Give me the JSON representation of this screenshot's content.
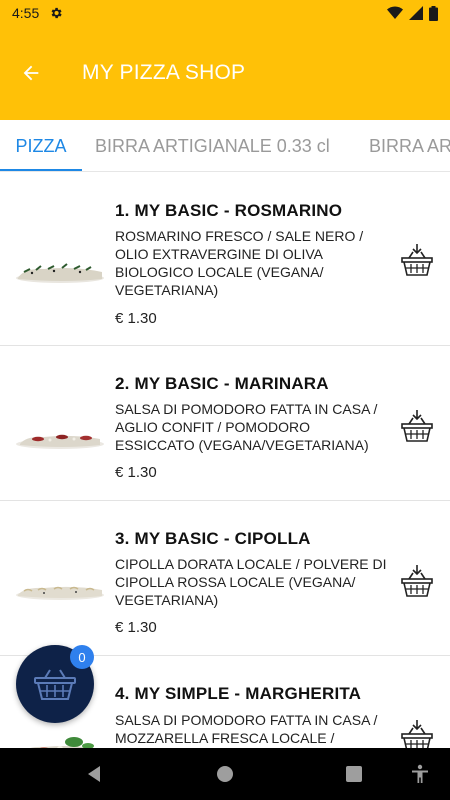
{
  "status": {
    "time": "4:55"
  },
  "appbar": {
    "title": "MY PIZZA SHOP"
  },
  "tabs": [
    {
      "label": "PIZZA",
      "active": true
    },
    {
      "label": "BIRRA ARTIGIANALE 0.33 cl",
      "active": false
    },
    {
      "label": "BIRRA AR",
      "active": false
    }
  ],
  "products": [
    {
      "name": "1. MY BASIC - ROSMARINO",
      "description": "ROSMARINO FRESCO / SALE NERO / OLIO EXTRAVERGINE DI OLIVA BIOLOGICO LOCALE   (VEGANA/ VEGETARIANA)",
      "price": "€ 1.30"
    },
    {
      "name": "2. MY BASIC - MARINARA",
      "description": "SALSA DI POMODORO FATTA IN CASA  / AGLIO CONFIT / POMODORO ESSICCATO   (VEGANA/VEGETARIANA)",
      "price": "€ 1.30"
    },
    {
      "name": "3. MY BASIC - CIPOLLA",
      "description": "CIPOLLA DORATA LOCALE / POLVERE DI CIPOLLA ROSSA LOCALE   (VEGANA/ VEGETARIANA)",
      "price": "€ 1.30"
    },
    {
      "name": "4. MY SIMPLE - MARGHERITA",
      "description": "SALSA DI POMODORO FATTA IN CASA / MOZZARELLA FRESCA LOCALE /",
      "price": ""
    }
  ],
  "cart": {
    "count": "0"
  },
  "colors": {
    "primary": "#FFC107",
    "accent": "#1E88E5",
    "fab": "#0E2248",
    "badge": "#2F80ED"
  }
}
